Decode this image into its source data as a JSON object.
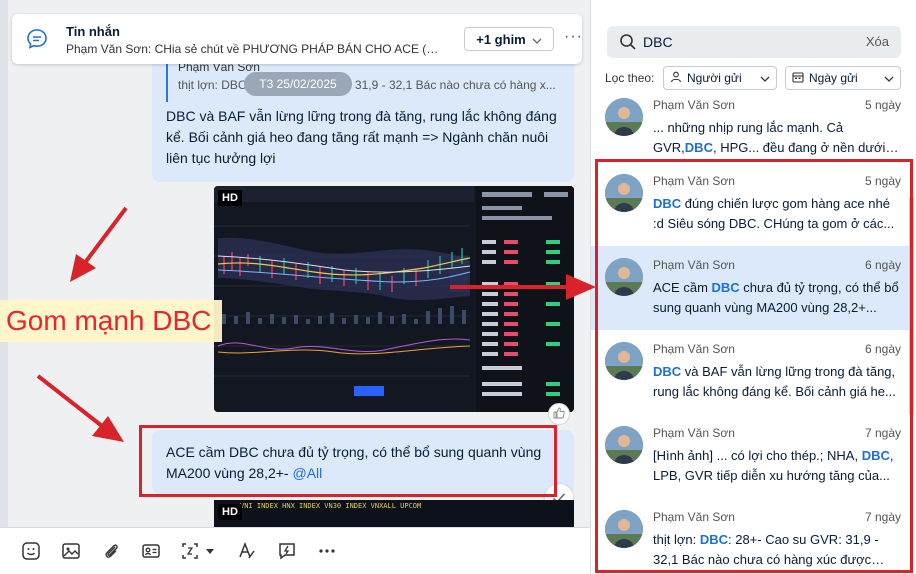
{
  "pinned": {
    "title": "Tin nhắn",
    "text": "Phạm Văn Sơn: CHia sẻ chút về PHƯƠNG PHÁP BÁN CHO ACE (Mu...",
    "pin_count_label": "+1 ghim"
  },
  "quote": {
    "author": "Phạm Văn Sơn",
    "text": "thịt lợn: DBC: 28+- Cao su GVR: 31,9 - 32,1 Bác nào chưa có hàng x..."
  },
  "date_badge": "T3 25/02/2025",
  "bubble_1_text": "DBC và BAF vẫn lừng lững trong đà tăng, rung lắc không đáng kể. Bối cảnh giá heo đang tăng rất mạnh => Ngành chăn nuôi liên tục hưởng lợi",
  "bubble_2": {
    "text": "ACE cầm DBC chưa đủ tỷ trọng, có thể bổ sung quanh vùng MA200 vùng 28,2+-",
    "mention": "@All"
  },
  "hd_label": "HD",
  "ticker_row": "VNI INDEX  HNX INDEX  VN30 INDEX  VNXALL  UPCOM",
  "annotation": {
    "label": "Gom mạnh DBC",
    "color": "#d8232a"
  },
  "search": {
    "value": "DBC",
    "clear_label": "Xóa",
    "filter_label": "Lọc theo:",
    "filter_sender": "Người gửi",
    "filter_date": "Ngày gửi"
  },
  "results": [
    {
      "sender": "Phạm Văn Sơn",
      "time": "5 ngày",
      "before": "... những nhịp rung lắc mạnh. Cả GVR,",
      "match": "DBC",
      "after": ", HPG... đều đang ở nền dưới và vào..."
    },
    {
      "sender": "Phạm Văn Sơn",
      "time": "5 ngày",
      "before": "",
      "match": "DBC",
      "after": " đúng chiến lược gom hàng ace nhé :d Siêu sóng DBC. CHúng ta gom ở các..."
    },
    {
      "sender": "Phạm Văn Sơn",
      "time": "6 ngày",
      "before": "ACE cầm ",
      "match": "DBC",
      "after": " chưa đủ tỷ trọng, có thể bổ sung quanh vùng MA200 vùng 28,2+..."
    },
    {
      "sender": "Phạm Văn Sơn",
      "time": "6 ngày",
      "before": "",
      "match": "DBC",
      "after": " và BAF vẫn lừng lững trong đà tăng, rung lắc không đáng kể. Bối cảnh giá he..."
    },
    {
      "sender": "Phạm Văn Sơn",
      "time": "7 ngày",
      "before": "[Hình ảnh] ... có lợi cho thép.; NHA, ",
      "match": "DBC",
      "after": ", LPB, GVR tiếp diễn xu hướng tăng của..."
    },
    {
      "sender": "Phạm Văn Sơn",
      "time": "7 ngày",
      "before": "thịt lợn: ",
      "match": "DBC",
      "after": ": 28+- Cao su GVR: 31,9 - 32,1 Bác nào chưa có hàng xúc được nh..."
    }
  ]
}
